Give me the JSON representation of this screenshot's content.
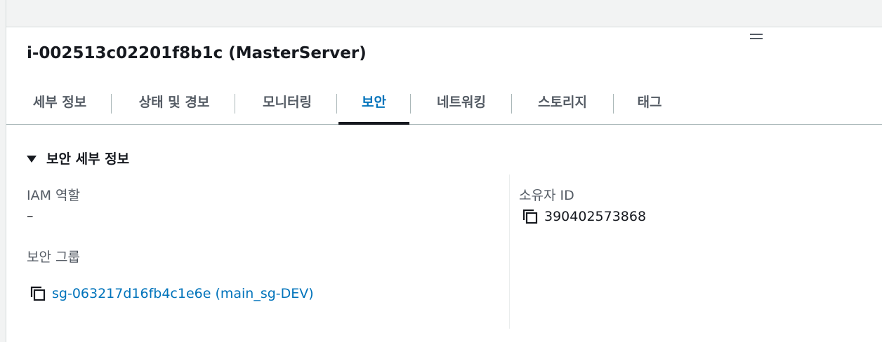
{
  "instance": {
    "title": "i-002513c02201f8b1c (MasterServer)"
  },
  "tabs": [
    {
      "label": "세부 정보"
    },
    {
      "label": "상태 및 경보"
    },
    {
      "label": "모니터링"
    },
    {
      "label": "보안",
      "active": true
    },
    {
      "label": "네트워킹"
    },
    {
      "label": "스토리지"
    },
    {
      "label": "태그"
    }
  ],
  "security": {
    "section_title": "보안 세부 정보",
    "iam_role_label": "IAM 역할",
    "iam_role_value": "–",
    "owner_id_label": "소유자 ID",
    "owner_id_value": "390402573868",
    "security_group_label": "보안 그룹",
    "security_group_value": "sg-063217d16fb4c1e6e (main_sg-DEV)"
  },
  "icons": {
    "copy": "copy-icon",
    "caret": "caret-down-icon",
    "drag": "drag-handle-icon"
  },
  "colors": {
    "link": "#0073bb",
    "active_tab": "#0073bb",
    "text": "#16191f",
    "label": "#545b64"
  }
}
